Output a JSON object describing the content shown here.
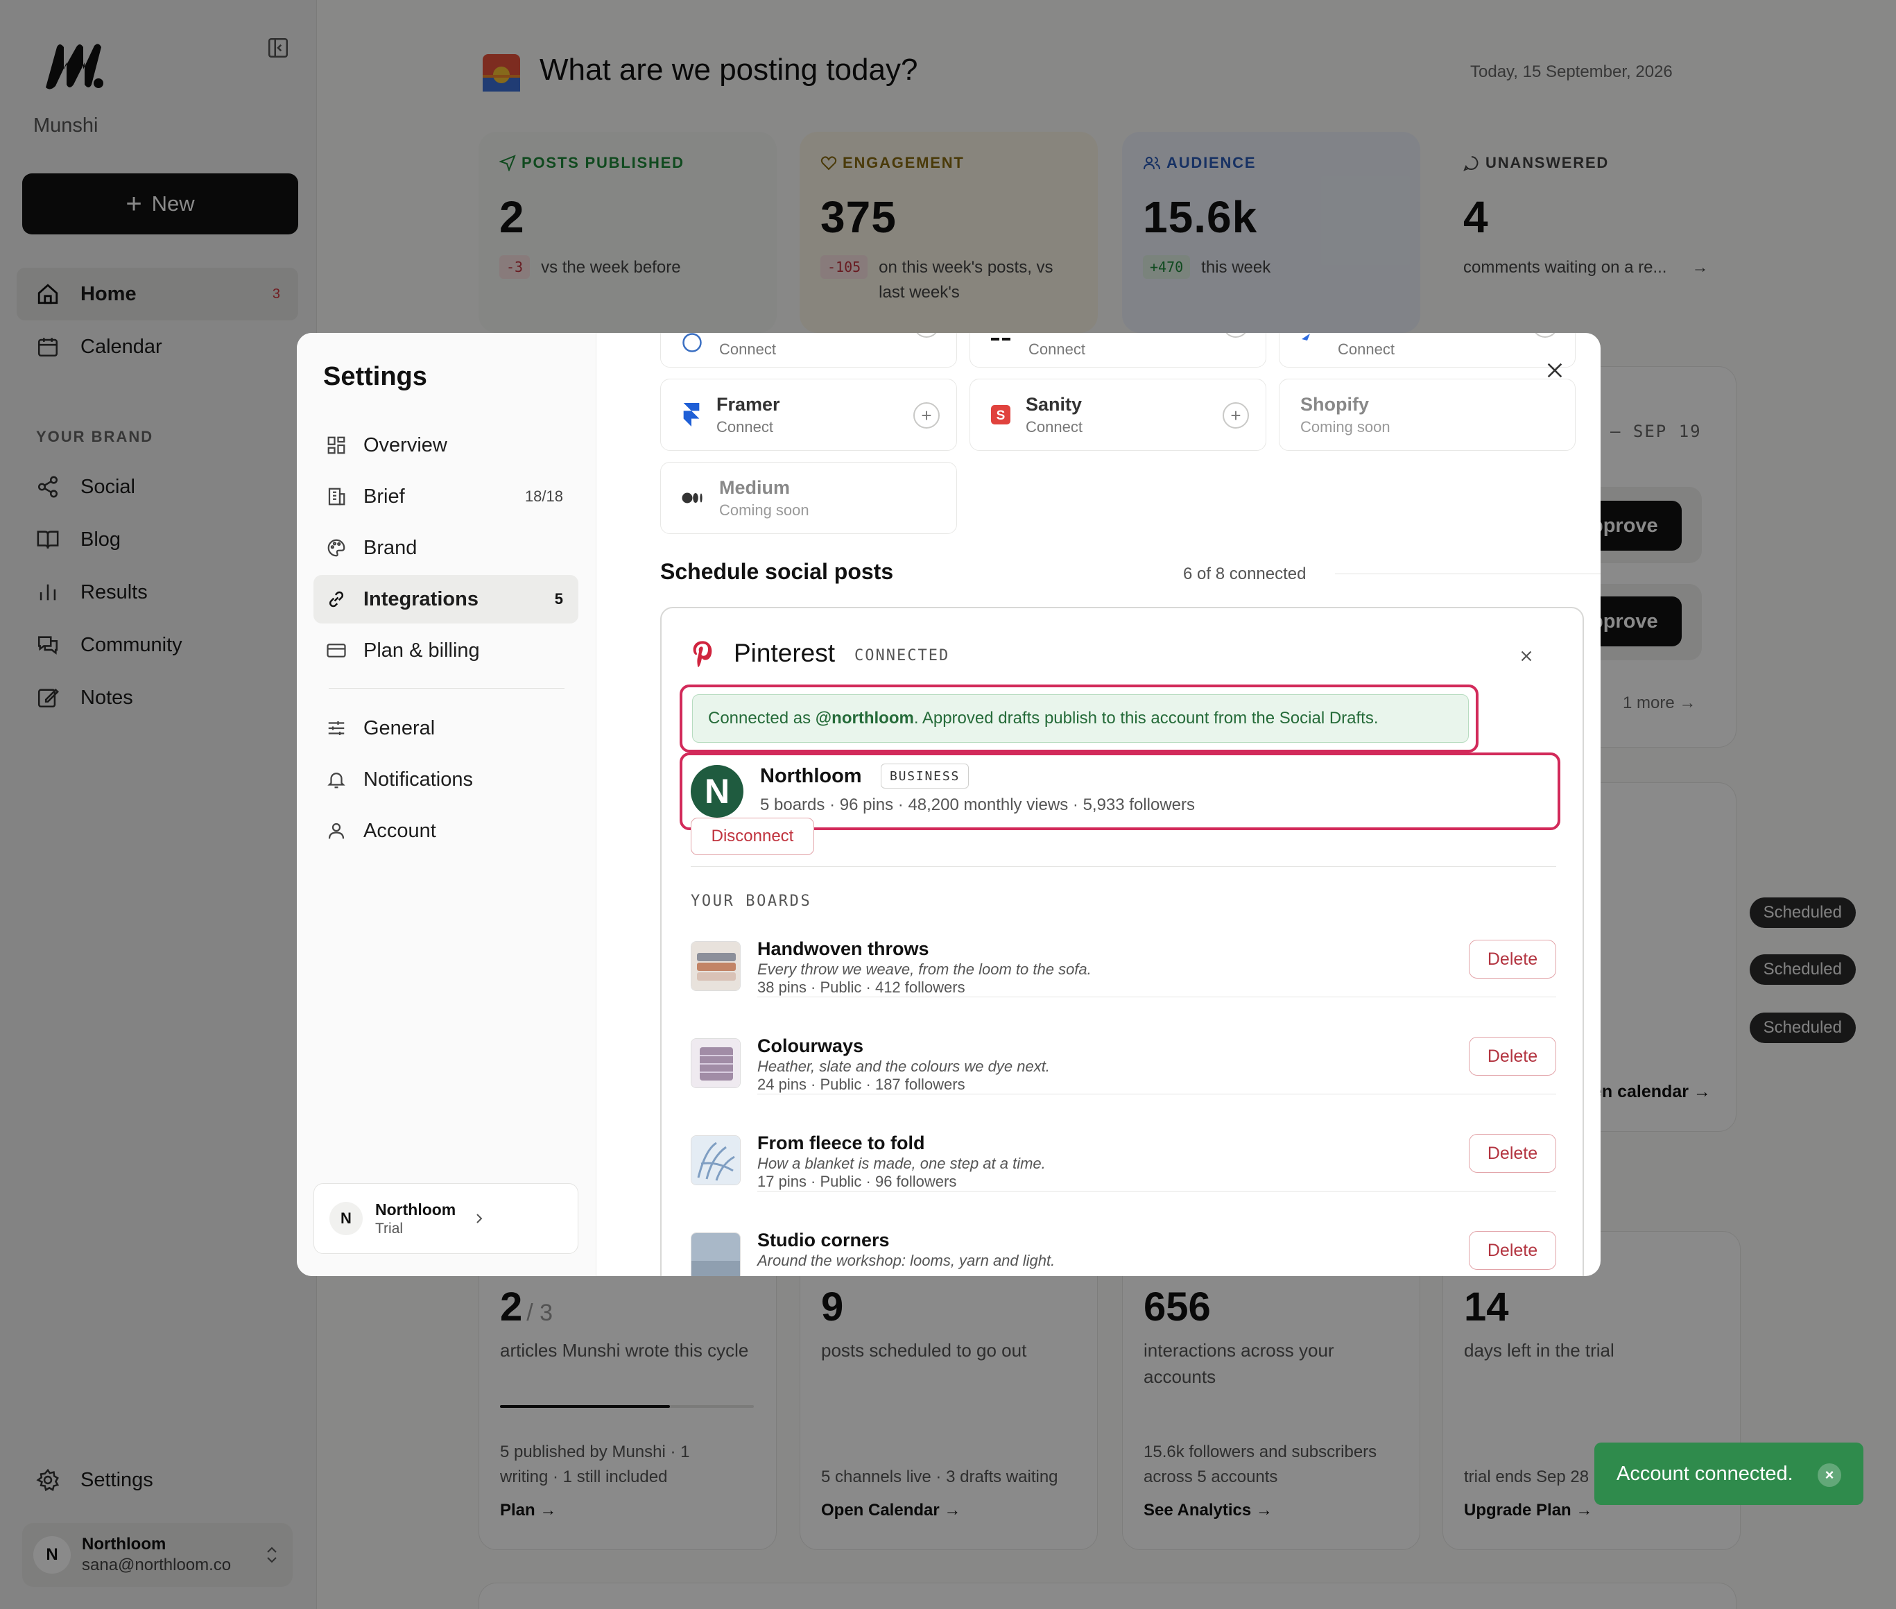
{
  "app": {
    "brand_name": "Munshi",
    "new_label": "New",
    "nav": [
      {
        "label": "Home",
        "badge": "3"
      },
      {
        "label": "Calendar"
      }
    ],
    "section_label": "YOUR BRAND",
    "brand_nav": [
      {
        "label": "Social"
      },
      {
        "label": "Blog"
      },
      {
        "label": "Results"
      },
      {
        "label": "Community"
      },
      {
        "label": "Notes"
      }
    ],
    "settings_label": "Settings",
    "user": {
      "initial": "N",
      "name": "Northloom",
      "email": "sana@northloom.co"
    }
  },
  "main": {
    "title": "What are we posting today?",
    "date": "Today, 15 September, 2026",
    "stats": [
      {
        "label": "POSTS PUBLISHED",
        "value": "2",
        "delta": "-3",
        "sub": "vs the week before",
        "color": "#1f8a3a"
      },
      {
        "label": "ENGAGEMENT",
        "value": "375",
        "delta": "-105",
        "sub": "on this week's posts, vs last week's",
        "color": "#8a6b12"
      },
      {
        "label": "AUDIENCE",
        "value": "15.6k",
        "delta": "+470",
        "sub": "this week",
        "color": "#2b5bb8"
      },
      {
        "label": "UNANSWERED",
        "value": "4",
        "sub": "comments waiting on a re..."
      }
    ],
    "right_panel": {
      "date_range": "– SEP 19",
      "approve_label": "pprove",
      "more_label": "1 more",
      "pills": [
        "Scheduled",
        "Scheduled",
        "Scheduled"
      ],
      "calendar_link": "en calendar →"
    },
    "bottom_stats": [
      {
        "value": "2",
        "of": "/ 3",
        "desc": "articles Munshi wrote this cycle",
        "foot": "5 published by Munshi · 1 writing · 1 still included",
        "link": "Plan →",
        "progress": 0.67
      },
      {
        "value": "9",
        "desc": "posts scheduled to go out",
        "foot": "5 channels live · 3 drafts waiting",
        "link": "Open Calendar →"
      },
      {
        "value": "656",
        "desc": "interactions across your accounts",
        "foot": "15.6k followers and subscribers across 5 accounts",
        "link": "See Analytics →"
      },
      {
        "value": "14",
        "desc": "days left in the trial",
        "foot": "trial ends Sep 28",
        "link": "Upgrade Plan →"
      }
    ]
  },
  "settings": {
    "title": "Settings",
    "nav": [
      {
        "label": "Overview"
      },
      {
        "label": "Brief",
        "count": "18/18"
      },
      {
        "label": "Brand"
      },
      {
        "label": "Integrations",
        "count": "5"
      },
      {
        "label": "Plan & billing"
      },
      {
        "label": "General"
      },
      {
        "label": "Notifications"
      },
      {
        "label": "Account"
      }
    ],
    "workspace": {
      "initial": "N",
      "name": "Northloom",
      "plan": "Trial"
    },
    "integrations_top": [
      {
        "status": "Connect"
      },
      {
        "status": "Connect"
      },
      {
        "status": "Connect"
      }
    ],
    "integrations": [
      {
        "name": "Framer",
        "status": "Connect"
      },
      {
        "name": "Sanity",
        "status": "Connect"
      },
      {
        "name": "Shopify",
        "status": "Coming soon"
      },
      {
        "name": "Medium",
        "status": "Coming soon"
      }
    ],
    "social_section": {
      "title": "Schedule social posts",
      "subtitle": "6 of 8 connected"
    },
    "pinterest": {
      "name": "Pinterest",
      "status": "CONNECTED",
      "banner_prefix": "Connected as ",
      "handle": "@northloom",
      "banner_suffix": ". Approved drafts publish to this account from the Social Drafts.",
      "account": {
        "initial": "N",
        "name": "Northloom",
        "badge": "BUSINESS",
        "stats": "5 boards · 96 pins · 48,200 monthly views · 5,933 followers"
      },
      "disconnect_label": "Disconnect",
      "boards_label": "YOUR BOARDS",
      "delete_label": "Delete",
      "boards": [
        {
          "title": "Handwoven throws",
          "desc": "Every throw we weave, from the loom to the sofa.",
          "meta": "38 pins · Public · 412 followers"
        },
        {
          "title": "Colourways",
          "desc": "Heather, slate and the colours we dye next.",
          "meta": "24 pins · Public · 187 followers"
        },
        {
          "title": "From fleece to fold",
          "desc": "How a blanket is made, one step at a time.",
          "meta": "17 pins · Public · 96 followers"
        },
        {
          "title": "Studio corners",
          "desc": "Around the workshop: looms, yarn and light.",
          "meta": ""
        }
      ]
    }
  },
  "toast": {
    "message": "Account connected."
  }
}
